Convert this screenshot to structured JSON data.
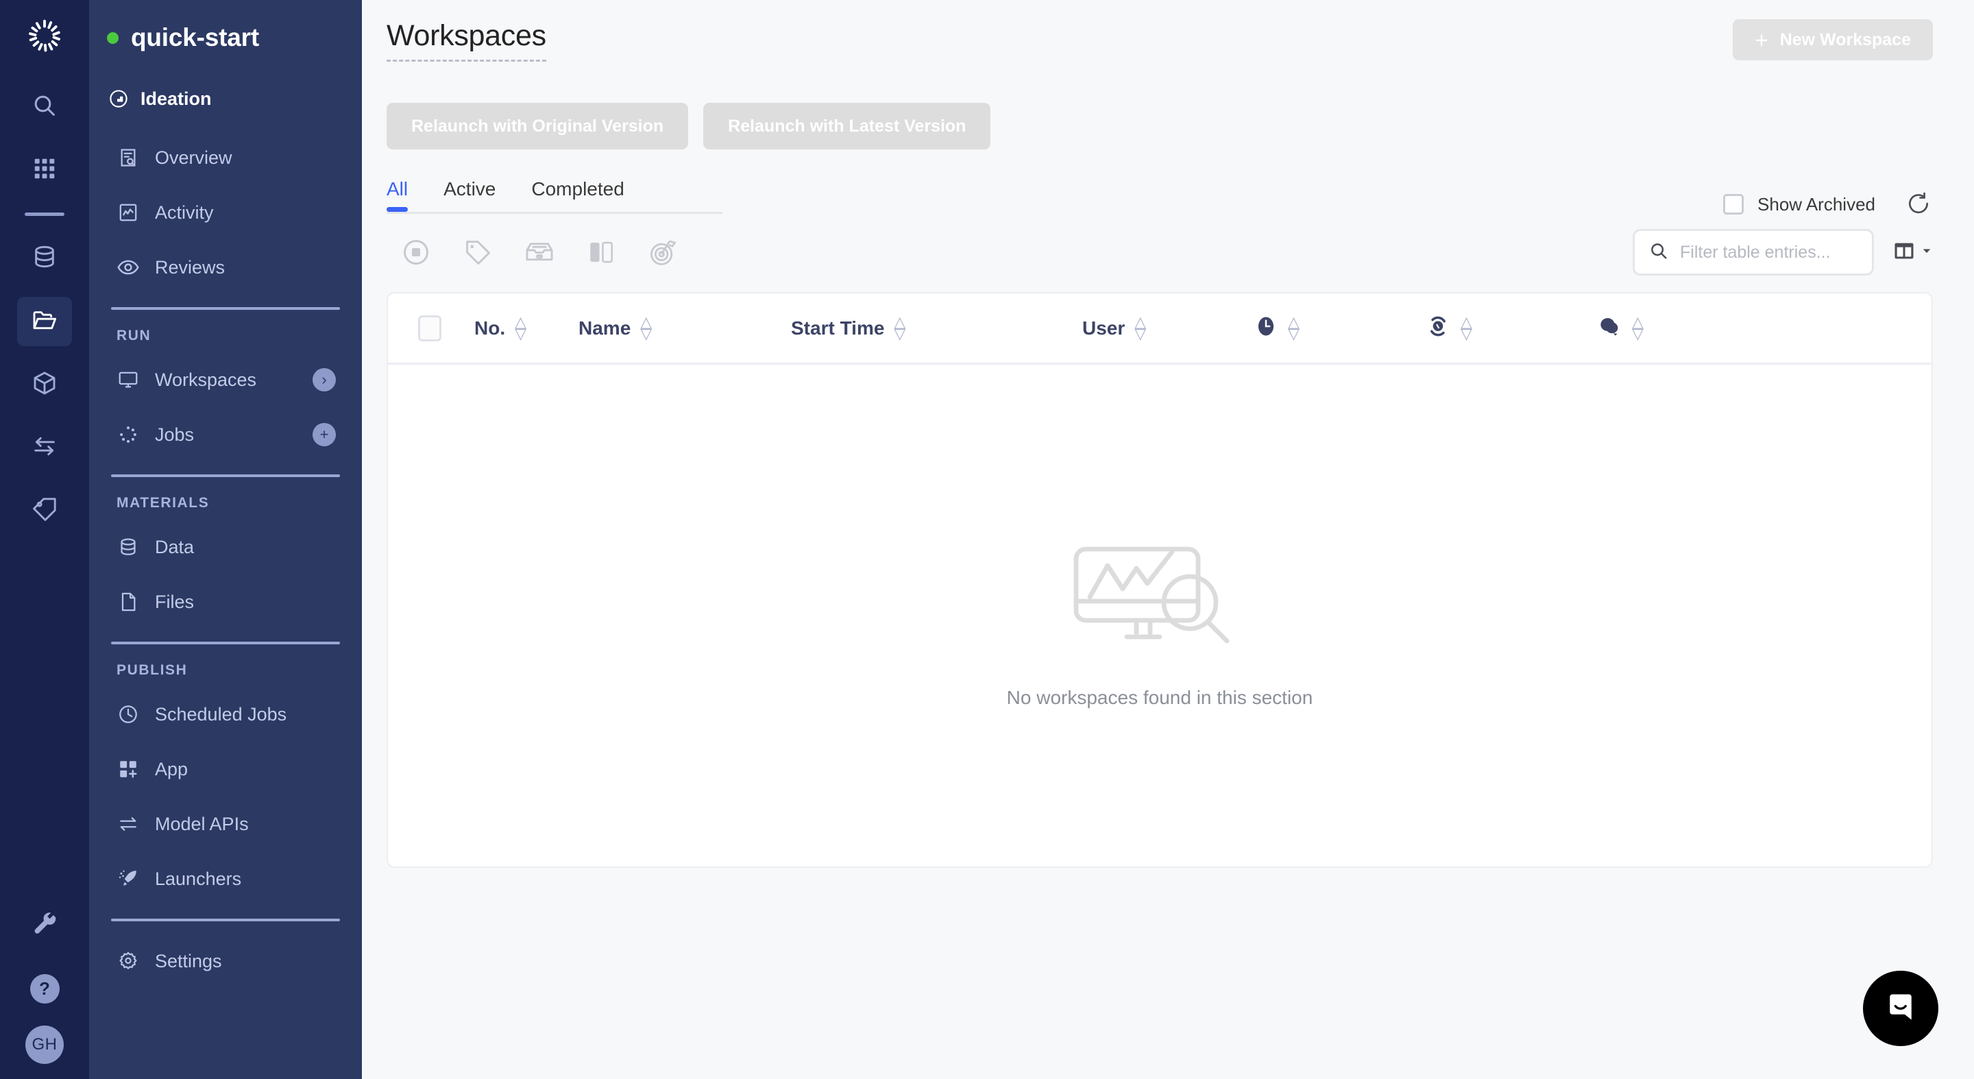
{
  "rail": {
    "logo_icon": "spinner-logo-icon",
    "items": [
      {
        "name": "search-icon",
        "active": false
      },
      {
        "name": "apps-grid-icon",
        "active": false
      },
      {
        "name": "database-icon",
        "active": false
      },
      {
        "name": "folder-open-icon",
        "active": true
      },
      {
        "name": "cube-icon",
        "active": false
      },
      {
        "name": "transfer-arrows-icon",
        "active": false
      },
      {
        "name": "tag-icon",
        "active": false
      }
    ],
    "wrench_icon": "wrench-icon",
    "help_label": "?",
    "avatar_initials": "GH"
  },
  "sidebar": {
    "project_name": "quick-start",
    "status_color": "#4cc93f",
    "phase": "Ideation",
    "top_items": [
      {
        "label": "Overview",
        "icon": "document-search-icon"
      },
      {
        "label": "Activity",
        "icon": "activity-chart-icon"
      },
      {
        "label": "Reviews",
        "icon": "eye-icon"
      }
    ],
    "groups": [
      {
        "title": "RUN",
        "items": [
          {
            "label": "Workspaces",
            "icon": "monitor-icon",
            "badge": "›",
            "badge_name": "chevron-right-badge"
          },
          {
            "label": "Jobs",
            "icon": "loading-dots-icon",
            "badge": "+",
            "badge_name": "plus-badge"
          }
        ]
      },
      {
        "title": "MATERIALS",
        "items": [
          {
            "label": "Data",
            "icon": "database-icon",
            "badge": "",
            "badge_name": ""
          },
          {
            "label": "Files",
            "icon": "file-icon",
            "badge": "",
            "badge_name": ""
          }
        ]
      },
      {
        "title": "PUBLISH",
        "items": [
          {
            "label": "Scheduled Jobs",
            "icon": "clock-icon",
            "badge": "",
            "badge_name": ""
          },
          {
            "label": "App",
            "icon": "app-squares-icon",
            "badge": "",
            "badge_name": ""
          },
          {
            "label": "Model APIs",
            "icon": "exchange-arrows-icon",
            "badge": "",
            "badge_name": ""
          },
          {
            "label": "Launchers",
            "icon": "rocket-icon",
            "badge": "",
            "badge_name": ""
          }
        ]
      }
    ],
    "settings": {
      "label": "Settings",
      "icon": "gear-icon"
    }
  },
  "header": {
    "title": "Workspaces",
    "new_workspace_label": "New Workspace",
    "new_workspace_plus": "+"
  },
  "actions": {
    "relaunch_original": "Relaunch with Original Version",
    "relaunch_latest": "Relaunch with Latest Version"
  },
  "tabs": [
    {
      "label": "All",
      "active": true
    },
    {
      "label": "Active",
      "active": false
    },
    {
      "label": "Completed",
      "active": false
    }
  ],
  "toolbar": {
    "icons": [
      {
        "name": "stop-circle-icon"
      },
      {
        "name": "tag-icon"
      },
      {
        "name": "archive-box-icon"
      },
      {
        "name": "split-panel-icon"
      },
      {
        "name": "goal-target-icon"
      }
    ]
  },
  "filters": {
    "show_archived_label": "Show Archived",
    "show_archived_checked": false,
    "refresh_icon": "refresh-icon",
    "search_placeholder": "Filter table entries...",
    "search_value": "",
    "search_icon": "search-icon",
    "columns_icon": "columns-settings-icon"
  },
  "table": {
    "columns": [
      {
        "label": "No.",
        "type": "text",
        "sortable": true
      },
      {
        "label": "Name",
        "type": "text",
        "sortable": true
      },
      {
        "label": "Start Time",
        "type": "text",
        "sortable": true
      },
      {
        "label": "User",
        "type": "text",
        "sortable": true
      },
      {
        "label": "",
        "type": "icon",
        "icon": "duration-clock-icon",
        "sortable": true
      },
      {
        "label": "",
        "type": "icon",
        "icon": "settings-sync-icon",
        "sortable": true
      },
      {
        "label": "",
        "type": "icon",
        "icon": "comments-icon",
        "sortable": true
      }
    ],
    "rows": [],
    "empty_message": "No workspaces found in this section",
    "empty_illustration": "monitor-chart-magnifier-icon"
  },
  "chat": {
    "icon": "intercom-chat-icon"
  },
  "colors": {
    "rail_bg": "#18224d",
    "sidebar_bg": "#2c3963",
    "accent_blue": "#3b62f6",
    "status_green": "#4cc93f",
    "main_bg": "#f7f8fa"
  }
}
